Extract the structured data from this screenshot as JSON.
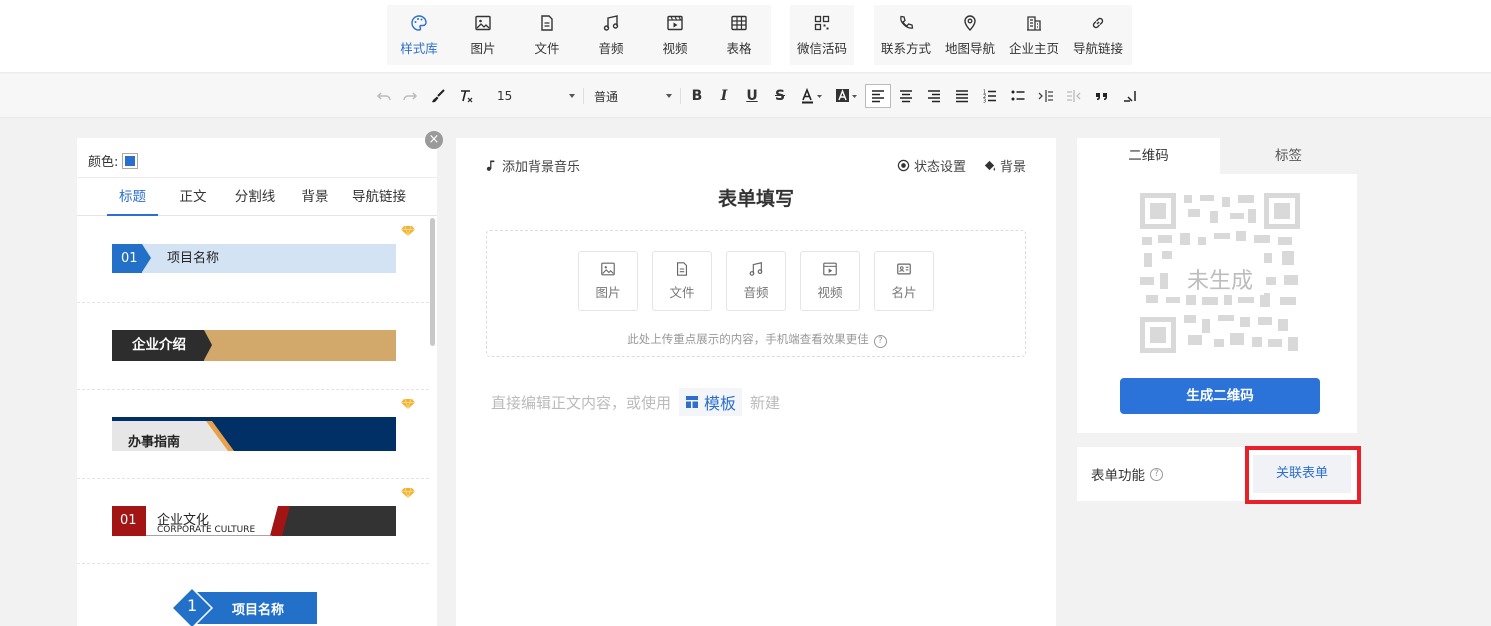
{
  "toolbar": {
    "items": [
      {
        "label": "样式库",
        "icon": "palette-icon"
      },
      {
        "label": "图片",
        "icon": "image-icon"
      },
      {
        "label": "文件",
        "icon": "file-icon"
      },
      {
        "label": "音频",
        "icon": "music-icon"
      },
      {
        "label": "视频",
        "icon": "video-icon"
      },
      {
        "label": "表格",
        "icon": "table-icon"
      },
      {
        "label": "微信活码",
        "icon": "qrcode-icon"
      },
      {
        "label": "联系方式",
        "icon": "phone-icon"
      },
      {
        "label": "地图导航",
        "icon": "map-pin-icon"
      },
      {
        "label": "企业主页",
        "icon": "building-icon"
      },
      {
        "label": "导航链接",
        "icon": "link-icon"
      }
    ],
    "active_index": 0
  },
  "format": {
    "font_size": "15",
    "paragraph": "普通"
  },
  "left": {
    "color_label": "颜色:",
    "color_value": "#2b6fcc",
    "tabs": [
      "标题",
      "正文",
      "分割线",
      "背景",
      "导航链接"
    ],
    "active_tab": 0,
    "styles": [
      {
        "num": "01",
        "text": "项目名称"
      },
      {
        "text": "企业介绍"
      },
      {
        "text": "办事指南"
      },
      {
        "num": "01",
        "text": "企业文化",
        "sub": "CORPORATE CULTURE"
      },
      {
        "num": "1",
        "text": "项目名称"
      }
    ]
  },
  "editor": {
    "music": "添加背景音乐",
    "status": "状态设置",
    "background": "背景",
    "title": "表单填写",
    "uploads": [
      "图片",
      "文件",
      "音频",
      "视频",
      "名片"
    ],
    "upload_hint": "此处上传重点展示的内容，手机端查看效果更佳",
    "placeholder_before": "直接编辑正文内容，或使用",
    "template": "模板",
    "placeholder_after": "新建"
  },
  "right": {
    "tabs": [
      "二维码",
      "标签"
    ],
    "qr_status": "未生成",
    "qr_button": "生成二维码",
    "form_label": "表单功能",
    "form_button": "关联表单"
  },
  "colors": {
    "accent": "#2b73d9",
    "highlight": "#e8202a"
  }
}
